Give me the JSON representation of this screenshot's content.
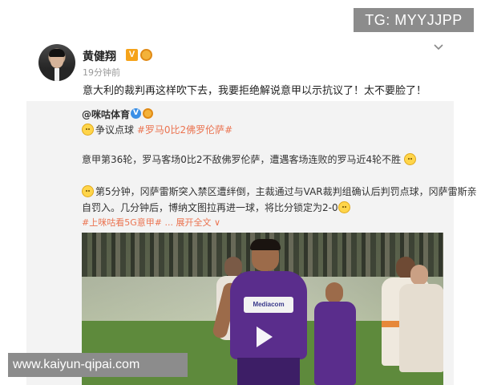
{
  "watermark_top": "TG: MYYJJPP",
  "watermark_bottom": "www.kaiyun-qipai.com",
  "post": {
    "author": "黄健翔",
    "vip_badge": "V",
    "time": "19分钟前",
    "text": "意大利的裁判再这样吹下去，我要拒绝解说意甲以示抗议了！太不要脸了！"
  },
  "repost": {
    "author": "@咪咕体育",
    "verified_badge": "V",
    "line_prefix": "争议点球 ",
    "hashtag": "#罗马0比2佛罗伦萨#",
    "para1": "意甲第36轮，罗马客场0比2不敌佛罗伦萨，遭遇客场连败的罗马近4轮不胜",
    "para2_a": "第5分钟，冈萨雷斯突入禁区遭绊倒，主裁通过与VAR裁判组确认后判罚点球，冈萨雷斯亲",
    "para2_b": "自罚入。几分钟后，博纳文图拉再进一球，将比分锁定为2-0",
    "promo": "#上咪咕看5G意甲# ",
    "expand": "... 展开全文",
    "expand_arrow": "∨",
    "sponsor_text": "Mediacom"
  },
  "icons": {
    "menu": "chevron-down-icon",
    "play": "play-icon"
  },
  "colors": {
    "link": "#eb7350",
    "badge_orange": "#f5a31a",
    "fiorentina_purple": "#5a2d8c"
  }
}
